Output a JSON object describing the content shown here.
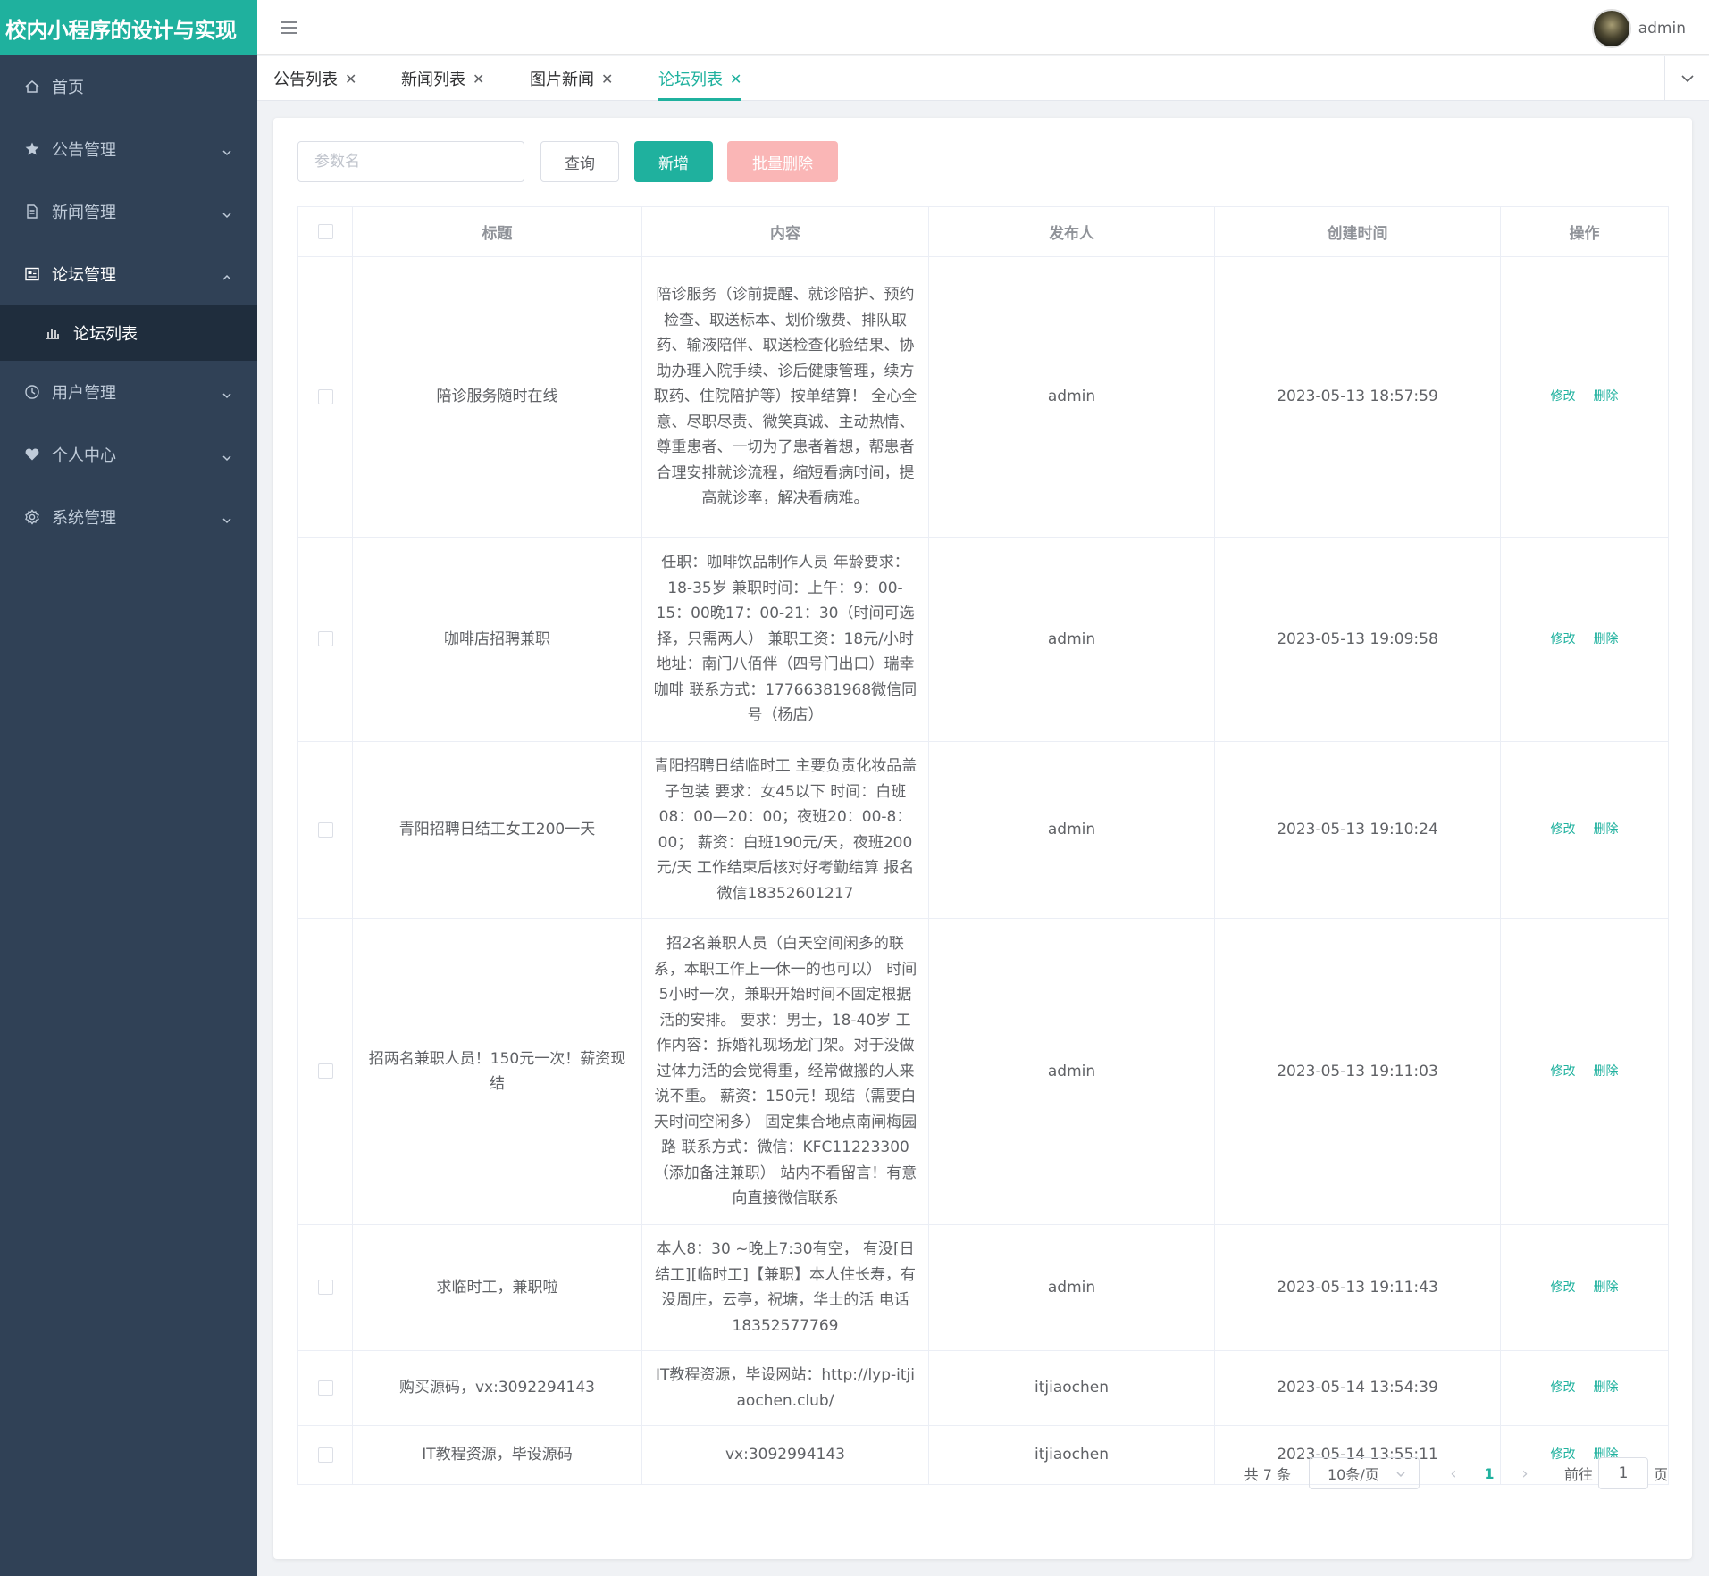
{
  "app": {
    "title": "校内小程序的设计与实现"
  },
  "header": {
    "user_name": "admin"
  },
  "sidebar": {
    "items": [
      {
        "label": "首页",
        "icon": "home-icon"
      },
      {
        "label": "公告管理",
        "icon": "star-icon"
      },
      {
        "label": "新闻管理",
        "icon": "document-icon"
      },
      {
        "label": "论坛管理",
        "icon": "newspaper-icon"
      },
      {
        "label": "用户管理",
        "icon": "clock-icon"
      },
      {
        "label": "个人中心",
        "icon": "heart-icon"
      },
      {
        "label": "系统管理",
        "icon": "gear-icon"
      }
    ],
    "subitem": {
      "label": "论坛列表",
      "icon": "bar-chart-icon"
    }
  },
  "tabs": [
    {
      "label": "公告列表"
    },
    {
      "label": "新闻列表"
    },
    {
      "label": "图片新闻"
    },
    {
      "label": "论坛列表"
    }
  ],
  "toolbar": {
    "search_placeholder": "参数名",
    "query_label": "查询",
    "add_label": "新增",
    "batch_delete_label": "批量删除"
  },
  "table": {
    "headers": {
      "title": "标题",
      "content": "内容",
      "publisher": "发布人",
      "created": "创建时间",
      "ops": "操作"
    },
    "edit_label": "修改",
    "delete_label": "删除",
    "rows": [
      {
        "title": "陪诊服务随时在线",
        "content": "陪诊服务（诊前提醒、就诊陪护、预约检查、取送标本、划价缴费、排队取药、输液陪伴、取送检查化验结果、协助办理入院手续、诊后健康管理，续方取药、住院陪护等）按单结算！ 全心全意、尽职尽责、微笑真诚、主动热情、尊重患者、一切为了患者着想，帮患者合理安排就诊流程，缩短看病时间，提高就诊率，解决看病难。",
        "publisher": "admin",
        "created": "2023-05-13 18:57:59"
      },
      {
        "title": "咖啡店招聘兼职",
        "content": "任职：咖啡饮品制作人员 年龄要求：18-35岁 兼职时间：上午：9：00-15：00晚17：00-21：30（时间可选择，只需两人） 兼职工资：18元/小时 地址：南门八佰伴（四号门出口）瑞幸咖啡 联系方式：17766381968微信同号（杨店）",
        "publisher": "admin",
        "created": "2023-05-13 19:09:58"
      },
      {
        "title": "青阳招聘日结工女工200一天",
        "content": "青阳招聘日结临时工 主要负责化妆品盖子包装 要求：女45以下 时间：白班08：00—20：00；夜班20：00-8：00； 薪资：白班190元/天，夜班200元/天 工作结束后核对好考勤结算 报名微信18352601217",
        "publisher": "admin",
        "created": "2023-05-13 19:10:24"
      },
      {
        "title": "招两名兼职人员！150元一次！薪资现结",
        "content": "招2名兼职人员（白天空间闲多的联系，本职工作上一休一的也可以） 时间5小时一次，兼职开始时间不固定根据活的安排。 要求：男士，18-40岁 工作内容：拆婚礼现场龙门架。对于没做过体力活的会觉得重，经常做搬的人来说不重。 薪资：150元！现结（需要白天时间空闲多） 固定集合地点南闸梅园路 联系方式：微信：KFC11223300（添加备注兼职） 站内不看留言！有意向直接微信联系",
        "publisher": "admin",
        "created": "2023-05-13 19:11:03"
      },
      {
        "title": "求临时工，兼职啦",
        "content": "本人8：30 ~晚上7:30有空， 有没[日结工][临时工]【兼职】本人住长寿，有没周庄，云亭，祝塘，华士的活 电话18352577769",
        "publisher": "admin",
        "created": "2023-05-13 19:11:43"
      },
      {
        "title": "购买源码，vx:3092294143",
        "content": "IT教程资源，毕设网站：http://lyp-itjiaochen.club/",
        "publisher": "itjiaochen",
        "created": "2023-05-14 13:54:39"
      },
      {
        "title": "IT教程资源，毕设源码",
        "content": "vx:3092994143",
        "publisher": "itjiaochen",
        "created": "2023-05-14 13:55:11"
      }
    ]
  },
  "pagination": {
    "total_label": "共 7 条",
    "page_size_label": "10条/页",
    "current_page": "1",
    "goto_label": "前往",
    "goto_value": "1",
    "page_suffix": "页"
  },
  "colors": {
    "accent": "#1fb19e",
    "sidebar_bg": "#304156",
    "danger_light": "#fab6b6"
  }
}
